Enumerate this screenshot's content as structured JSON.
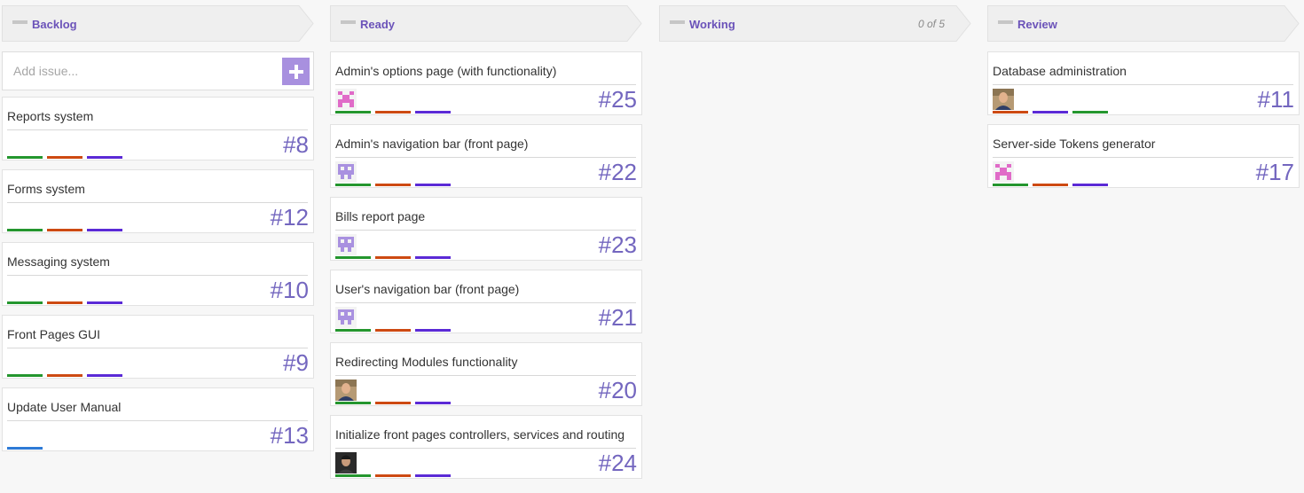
{
  "colors": {
    "green": "#24962e",
    "orange": "#cd4a12",
    "purple": "#5b2ad6",
    "blue": "#2e7ad6",
    "accent": "#6b53b9"
  },
  "columns": [
    {
      "title": "Backlog",
      "wip": "",
      "add": {
        "placeholder": "Add issue...",
        "icon": "plus-icon"
      },
      "cards": [
        {
          "title": "Reports system",
          "number": "#8",
          "avatar": "",
          "tags": [
            "green",
            "orange",
            "purple"
          ]
        },
        {
          "title": "Forms system",
          "number": "#12",
          "avatar": "",
          "tags": [
            "green",
            "orange",
            "purple"
          ]
        },
        {
          "title": "Messaging system",
          "number": "#10",
          "avatar": "",
          "tags": [
            "green",
            "orange",
            "purple"
          ]
        },
        {
          "title": "Front Pages GUI",
          "number": "#9",
          "avatar": "",
          "tags": [
            "green",
            "orange",
            "purple"
          ]
        },
        {
          "title": "Update User Manual",
          "number": "#13",
          "avatar": "",
          "tags": [
            "blue"
          ]
        }
      ]
    },
    {
      "title": "Ready",
      "wip": "",
      "cards": [
        {
          "title": "Admin's options page (with functionality)",
          "number": "#25",
          "avatar": "pink-identicon",
          "tags": [
            "green",
            "orange",
            "purple"
          ]
        },
        {
          "title": "Admin's navigation bar (front page)",
          "number": "#22",
          "avatar": "purple-identicon",
          "tags": [
            "green",
            "orange",
            "purple"
          ]
        },
        {
          "title": "Bills report page",
          "number": "#23",
          "avatar": "purple-identicon",
          "tags": [
            "green",
            "orange",
            "purple"
          ]
        },
        {
          "title": "User's navigation bar (front page)",
          "number": "#21",
          "avatar": "purple-identicon",
          "tags": [
            "green",
            "orange",
            "purple"
          ]
        },
        {
          "title": "Redirecting Modules functionality",
          "number": "#20",
          "avatar": "photo",
          "tags": [
            "green",
            "orange",
            "purple"
          ]
        },
        {
          "title": "Initialize front pages controllers, services and routing",
          "number": "#24",
          "avatar": "photo-dark",
          "tags": [
            "green",
            "orange",
            "purple"
          ]
        }
      ]
    },
    {
      "title": "Working",
      "wip": "0 of 5",
      "cards": []
    },
    {
      "title": "Review",
      "wip": "",
      "cards": [
        {
          "title": "Database administration",
          "number": "#11",
          "avatar": "photo",
          "tags": [
            "orange",
            "purple",
            "green"
          ]
        },
        {
          "title": "Server-side Tokens generator",
          "number": "#17",
          "avatar": "pink-identicon",
          "tags": [
            "green",
            "orange",
            "purple"
          ]
        }
      ]
    }
  ]
}
